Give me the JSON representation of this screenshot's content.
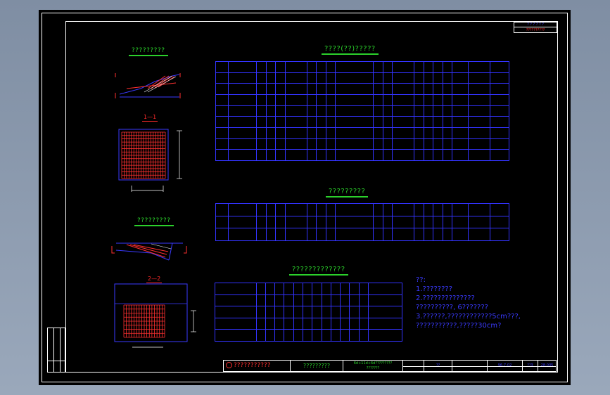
{
  "corner": {
    "line1": "? ? ? ? ? ?",
    "line2": "??????????"
  },
  "titles": {
    "drawing_a": "?????????",
    "section_1": "1—1",
    "drawing_b": "?????????",
    "section_2": "2—2",
    "table1": "????(??)?????",
    "table2": "?????????",
    "table3": "?????????????"
  },
  "notes": [
    "??:",
    "1.????????",
    "2.??????????????",
    "  ??????????, 6???????",
    "3.??????,????????????5cm???,",
    "  ???????????,?????30cm?"
  ],
  "titleblock": {
    "company": "???????????",
    "project": "?????????",
    "drawing_line1": "6d+11d+6d?????????",
    "drawing_line2": "???????",
    "scale_label": "??",
    "date": "96-7-02",
    "sheet": "??3",
    "sheet_no": "28-005"
  },
  "colors": {
    "background": "#000000",
    "line_blue": "#3333ff",
    "title_green": "#2bd12b",
    "section_red": "#ff2a2a",
    "rebar_red": "#ff3030"
  }
}
